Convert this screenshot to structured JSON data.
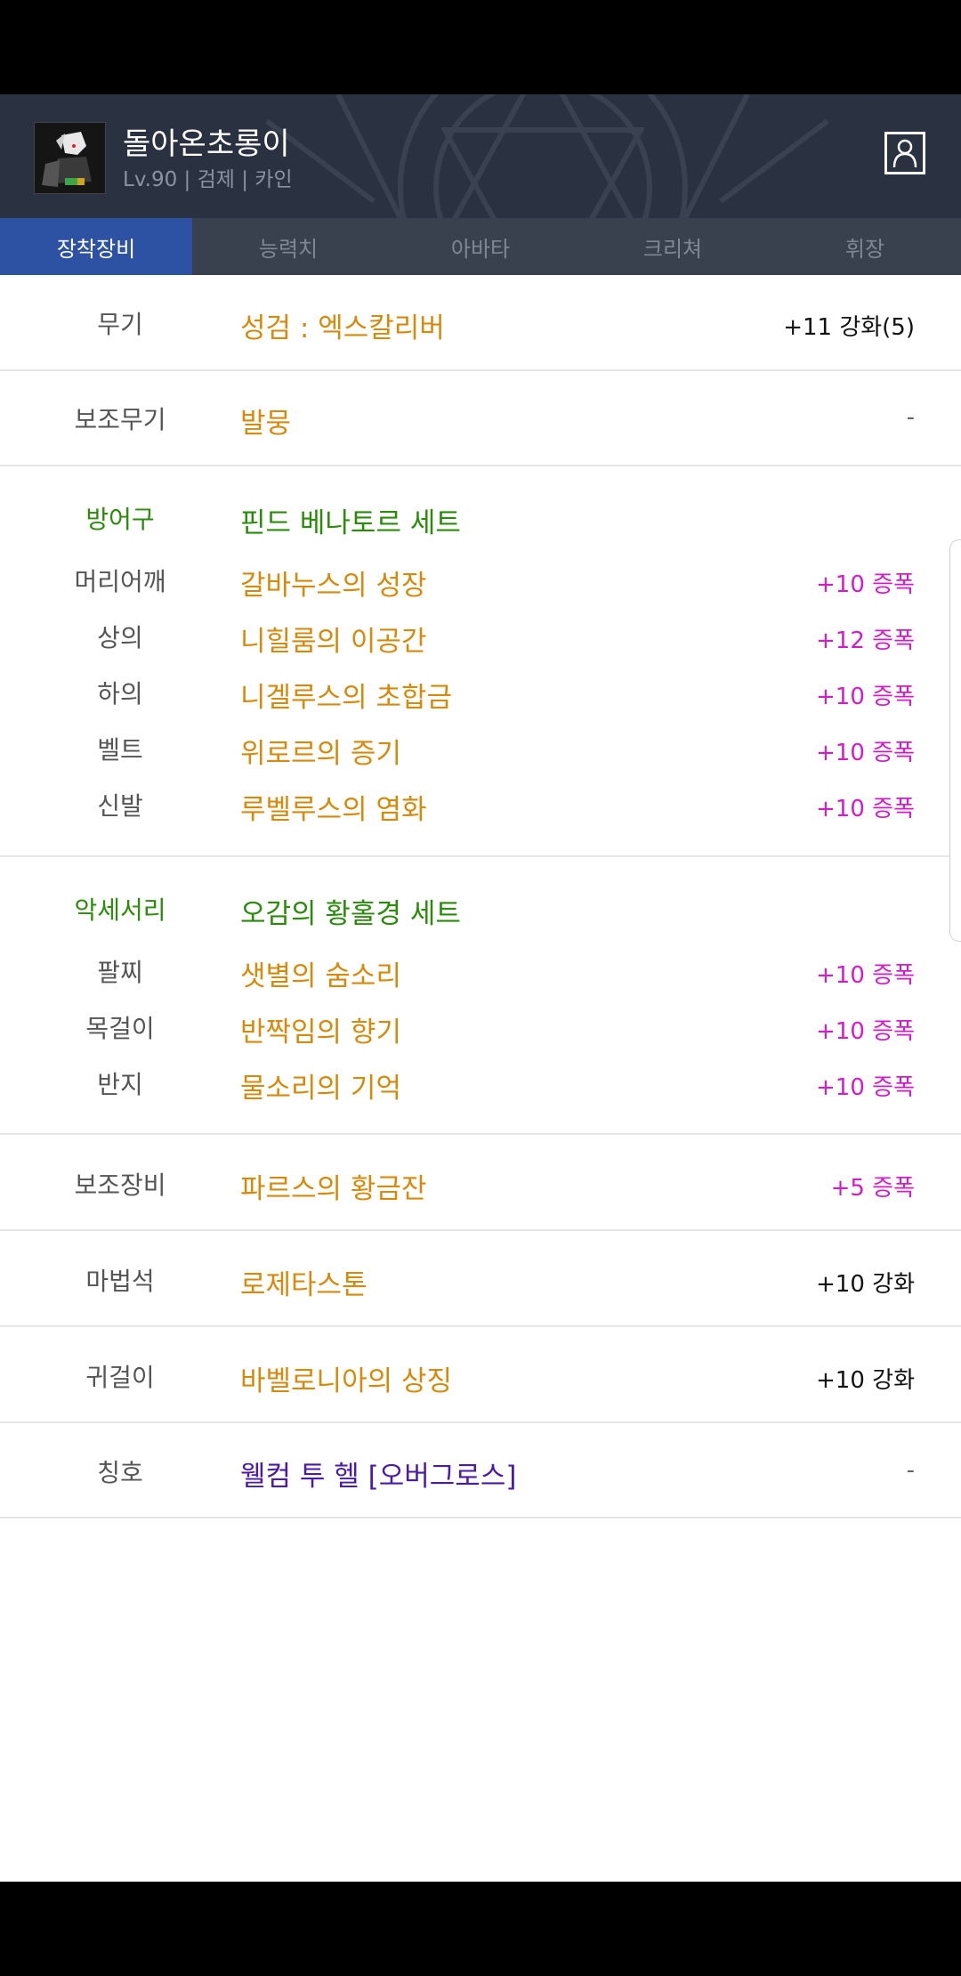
{
  "character": {
    "name": "돌아온초롱이",
    "info": "Lv.90 | 검제 | 카인"
  },
  "tabs": [
    {
      "label": "장착장비",
      "active": true
    },
    {
      "label": "능력치",
      "active": false
    },
    {
      "label": "아바타",
      "active": false
    },
    {
      "label": "크리쳐",
      "active": false
    },
    {
      "label": "휘장",
      "active": false
    }
  ],
  "equipment": {
    "weapon": {
      "category": "무기",
      "name": "성검 : 엑스칼리버",
      "value": "+11 강화(5)"
    },
    "sub_weapon": {
      "category": "보조무기",
      "name": "발뭉",
      "value": "-"
    },
    "armor_set": {
      "category": "방어구",
      "set_name": "핀드 베나토르 세트",
      "items": [
        {
          "category": "머리어깨",
          "name": "갈바누스의 성장",
          "value": "+10 증폭"
        },
        {
          "category": "상의",
          "name": "니힐룸의 이공간",
          "value": "+12 증폭"
        },
        {
          "category": "하의",
          "name": "니겔루스의 초합금",
          "value": "+10 증폭"
        },
        {
          "category": "벨트",
          "name": "위로르의 증기",
          "value": "+10 증폭"
        },
        {
          "category": "신발",
          "name": "루벨루스의 염화",
          "value": "+10 증폭"
        }
      ]
    },
    "accessory_set": {
      "category": "악세서리",
      "set_name": "오감의 황홀경 세트",
      "items": [
        {
          "category": "팔찌",
          "name": "샛별의 숨소리",
          "value": "+10 증폭"
        },
        {
          "category": "목걸이",
          "name": "반짝임의 향기",
          "value": "+10 증폭"
        },
        {
          "category": "반지",
          "name": "물소리의 기억",
          "value": "+10 증폭"
        }
      ]
    },
    "support": {
      "category": "보조장비",
      "name": "파르스의 황금잔",
      "value": "+5 증폭"
    },
    "magic_stone": {
      "category": "마법석",
      "name": "로제타스톤",
      "value": "+10 강화"
    },
    "earring": {
      "category": "귀걸이",
      "name": "바벨로니아의 상징",
      "value": "+10 강화"
    },
    "title": {
      "category": "칭호",
      "name": "웰컴 투 헬 [오버그로스]",
      "value": "-"
    }
  },
  "colors": {
    "header_bg": "#2a3140",
    "tab_active": "#2e52a3",
    "item_gold": "#d68a0c",
    "set_green": "#2b8b0b",
    "amplify_pink": "#d21cc8",
    "title_purple": "#4a1aa8"
  },
  "icons": {
    "profile": "person-icon"
  }
}
